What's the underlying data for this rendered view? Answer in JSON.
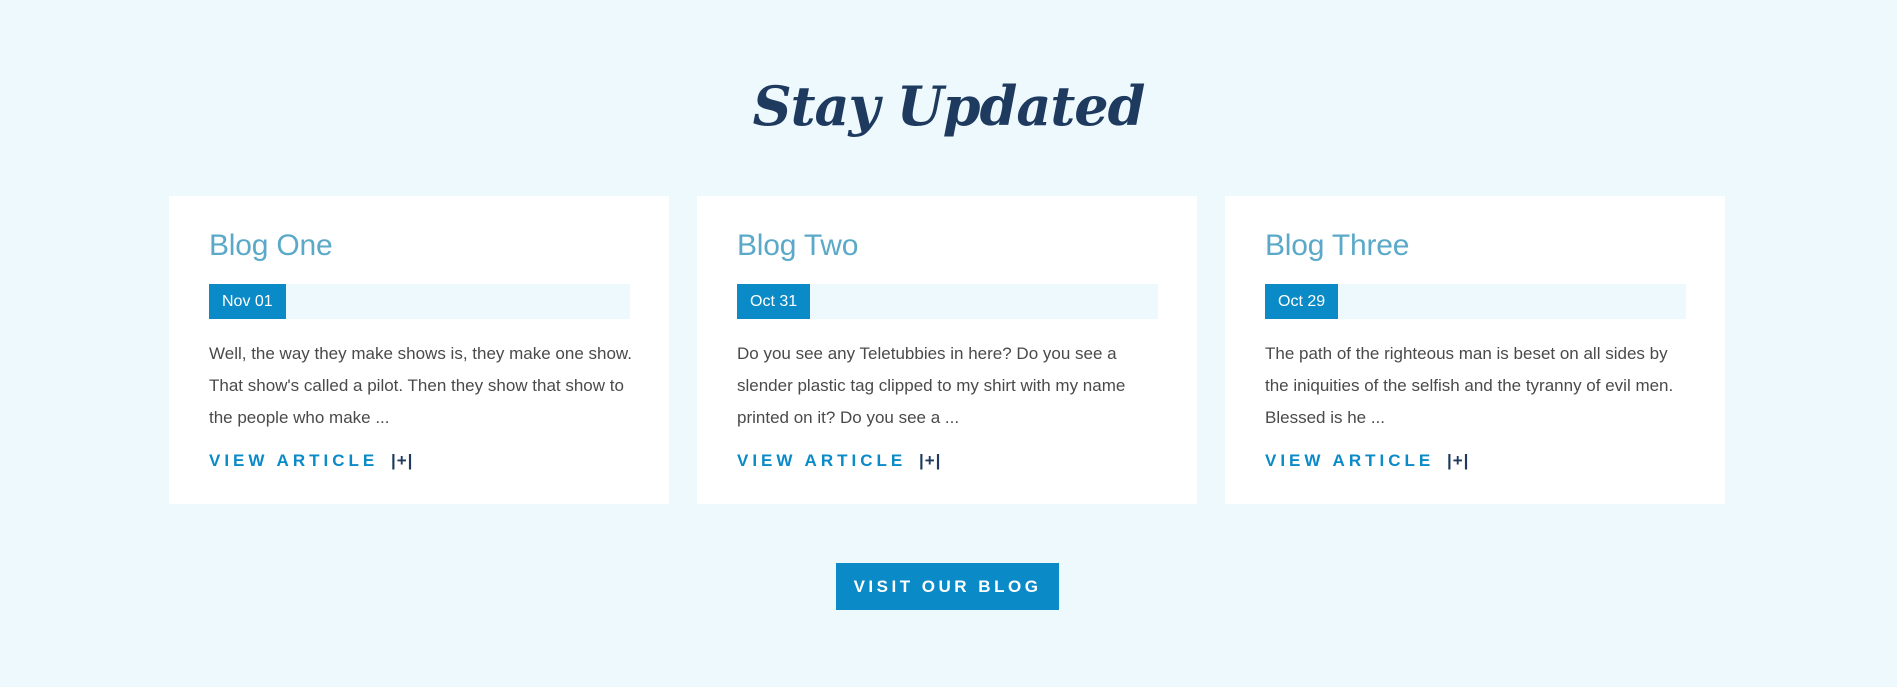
{
  "section": {
    "title": "Stay Updated"
  },
  "posts": [
    {
      "title": "Blog One",
      "date": "Nov 01",
      "excerpt": "Well, the way they make shows is, they make one show. That show's called a pilot. Then they show that show to the people who make ...",
      "link_label": "VIEW ARTICLE",
      "link_icon": "|+|"
    },
    {
      "title": "Blog Two",
      "date": "Oct 31",
      "excerpt": "Do you see any Teletubbies in here? Do you see a slender plastic tag clipped to my shirt with my name printed on it? Do you see a ...",
      "link_label": "VIEW ARTICLE",
      "link_icon": "|+|"
    },
    {
      "title": "Blog Three",
      "date": "Oct 29",
      "excerpt": "The path of the righteous man is beset on all sides by the iniquities of the selfish and the tyranny of evil men. Blessed is he ...",
      "link_label": "VIEW ARTICLE",
      "link_icon": "|+|"
    }
  ],
  "cta": {
    "label": "VISIT OUR BLOG"
  },
  "colors": {
    "background": "#eef9fe",
    "title": "#1e3a5f",
    "card_title": "#5aa9c9",
    "accent": "#0a8ac6",
    "text": "#4a4a4a"
  }
}
